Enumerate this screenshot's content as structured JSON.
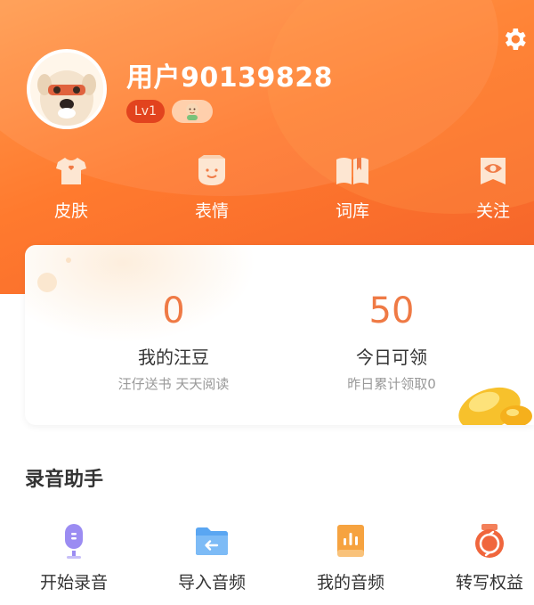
{
  "profile": {
    "username": "用户90139828",
    "level": "Lv1",
    "avatar_icon": "dog-avatar-icon",
    "medal_icon": "baby-medal-icon"
  },
  "header": {
    "settings_icon": "gear-icon"
  },
  "quick_actions": [
    {
      "label": "皮肤",
      "icon": "tshirt-icon"
    },
    {
      "label": "表情",
      "icon": "smile-bag-icon"
    },
    {
      "label": "词库",
      "icon": "book-icon"
    },
    {
      "label": "关注",
      "icon": "eye-icon"
    }
  ],
  "stats": {
    "coins": {
      "value": "0",
      "title": "我的汪豆",
      "subtitle": "汪仔送书 天天阅读"
    },
    "today": {
      "value": "50",
      "title": "今日可领",
      "subtitle": "昨日累计领取0"
    }
  },
  "recorder": {
    "section_title": "录音助手",
    "tools": [
      {
        "label": "开始录音",
        "icon": "microphone-icon"
      },
      {
        "label": "导入音频",
        "icon": "import-folder-icon"
      },
      {
        "label": "我的音频",
        "icon": "audio-document-icon"
      },
      {
        "label": "转写权益",
        "icon": "transcribe-rights-icon"
      }
    ]
  },
  "colors": {
    "brand_orange": "#ff7a2e",
    "accent_number": "#ef7a45"
  }
}
